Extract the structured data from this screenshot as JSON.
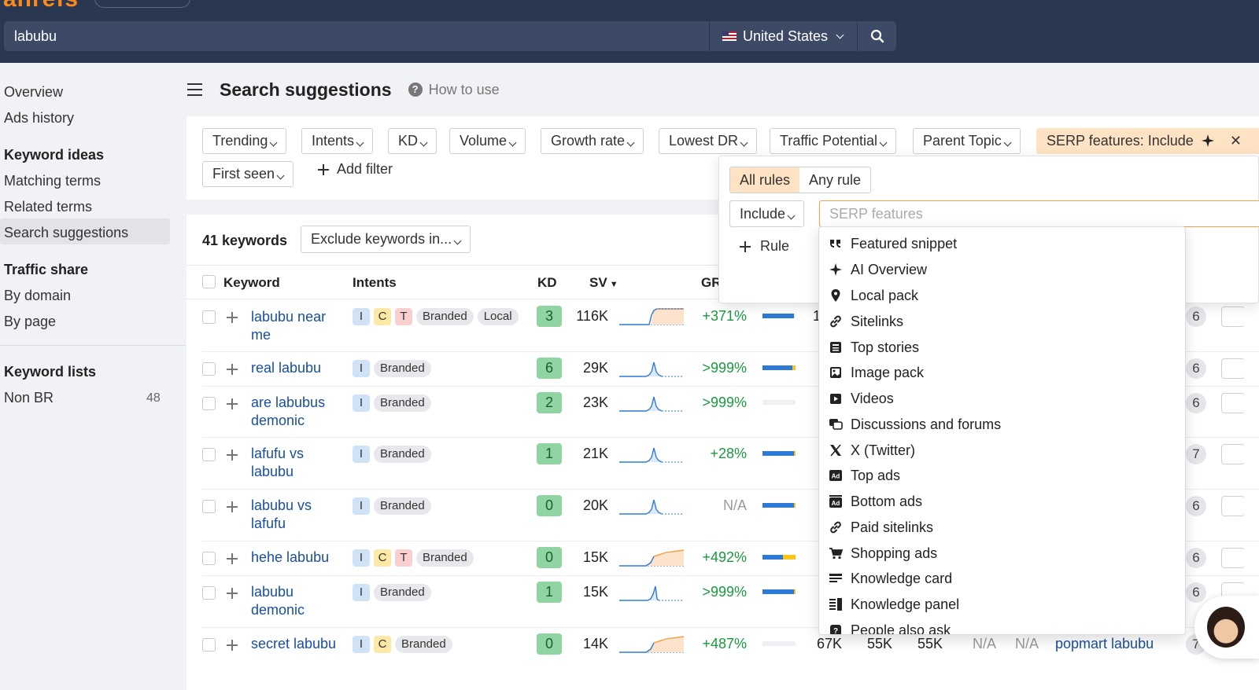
{
  "header": {
    "logo": "ahrefs",
    "search_value": "labubu",
    "country": "United States"
  },
  "sidebar": {
    "links_top": [
      "Overview",
      "Ads history"
    ],
    "keyword_ideas_heading": "Keyword ideas",
    "keyword_ideas": [
      "Matching terms",
      "Related terms",
      "Search suggestions"
    ],
    "traffic_share_heading": "Traffic share",
    "traffic_share": [
      "By domain",
      "By page"
    ],
    "keyword_lists_heading": "Keyword lists",
    "list_name": "Non BR",
    "list_count": "48"
  },
  "page": {
    "title": "Search suggestions",
    "help": "How to use"
  },
  "filters": {
    "chips": [
      "Trending",
      "Intents",
      "KD",
      "Volume",
      "Growth rate",
      "Lowest DR",
      "Traffic Potential",
      "Parent Topic",
      "SERP features: Include"
    ],
    "first_seen": "First seen",
    "add_filter": "Add filter"
  },
  "results": {
    "count": "41 keywords",
    "exclude": "Exclude keywords in...",
    "headers": {
      "keyword": "Keyword",
      "intents": "Intents",
      "kd": "KD",
      "sv": "SV",
      "gr": "GR"
    }
  },
  "rows": [
    {
      "keyword": "labubu near me",
      "tags": [
        "I",
        "C",
        "T",
        "Branded",
        "Local"
      ],
      "kd": "3",
      "sv": "116K",
      "gr": "+371%",
      "bubble": "6"
    },
    {
      "keyword": "real labubu",
      "tags": [
        "I",
        "Branded"
      ],
      "kd": "6",
      "sv": "29K",
      "gr": ">999%",
      "bubble": "6"
    },
    {
      "keyword": "are labubus demonic",
      "tags": [
        "I",
        "Branded"
      ],
      "kd": "2",
      "sv": "23K",
      "gr": ">999%",
      "bubble": "6"
    },
    {
      "keyword": "lafufu vs labubu",
      "tags": [
        "I",
        "Branded"
      ],
      "kd": "1",
      "sv": "21K",
      "gr": "+28%",
      "bubble": "7"
    },
    {
      "keyword": "labubu vs lafufu",
      "tags": [
        "I",
        "Branded"
      ],
      "kd": "0",
      "sv": "20K",
      "gr": "N/A",
      "bubble": "6"
    },
    {
      "keyword": "hehe labubu",
      "tags": [
        "I",
        "C",
        "T",
        "Branded"
      ],
      "kd": "0",
      "sv": "15K",
      "gr": "+492%",
      "bubble": "6"
    },
    {
      "keyword": "labubu demonic",
      "tags": [
        "I",
        "Branded"
      ],
      "kd": "1",
      "sv": "15K",
      "gr": ">999%",
      "bubble": "6"
    },
    {
      "keyword": "secret labubu",
      "tags": [
        "I",
        "C",
        "Branded"
      ],
      "kd": "0",
      "sv": "14K",
      "gr": "+487%",
      "bubble": "7"
    }
  ],
  "last_row_extra": {
    "tp": "67K",
    "c1": "55K",
    "c2": "55K",
    "na1": "N/A",
    "na2": "N/A",
    "parent": "popmart labubu"
  },
  "popover": {
    "all_rules": "All rules",
    "any_rule": "Any rule",
    "include": "Include",
    "placeholder": "SERP features",
    "rule": "Rule"
  },
  "serp_features": [
    {
      "label": "Featured snippet",
      "icon": "quote-icon"
    },
    {
      "label": "AI Overview",
      "icon": "sparkle-icon"
    },
    {
      "label": "Local pack",
      "icon": "map-pin-icon"
    },
    {
      "label": "Sitelinks",
      "icon": "link-icon"
    },
    {
      "label": "Top stories",
      "icon": "newspaper-icon"
    },
    {
      "label": "Image pack",
      "icon": "image-icon"
    },
    {
      "label": "Videos",
      "icon": "video-icon"
    },
    {
      "label": "Discussions and forums",
      "icon": "chat-icon"
    },
    {
      "label": "X (Twitter)",
      "icon": "x-icon"
    },
    {
      "label": "Top ads",
      "icon": "ad-icon"
    },
    {
      "label": "Bottom ads",
      "icon": "ad-icon"
    },
    {
      "label": "Paid sitelinks",
      "icon": "link-icon"
    },
    {
      "label": "Shopping ads",
      "icon": "cart-icon"
    },
    {
      "label": "Knowledge card",
      "icon": "card-icon"
    },
    {
      "label": "Knowledge panel",
      "icon": "panel-icon"
    },
    {
      "label": "People also ask",
      "icon": "question-icon"
    }
  ],
  "colors": {
    "nav": "#2a3751",
    "accent": "#ff8a1c",
    "link": "#1a4fa0",
    "positive": "#1a9a3f"
  }
}
